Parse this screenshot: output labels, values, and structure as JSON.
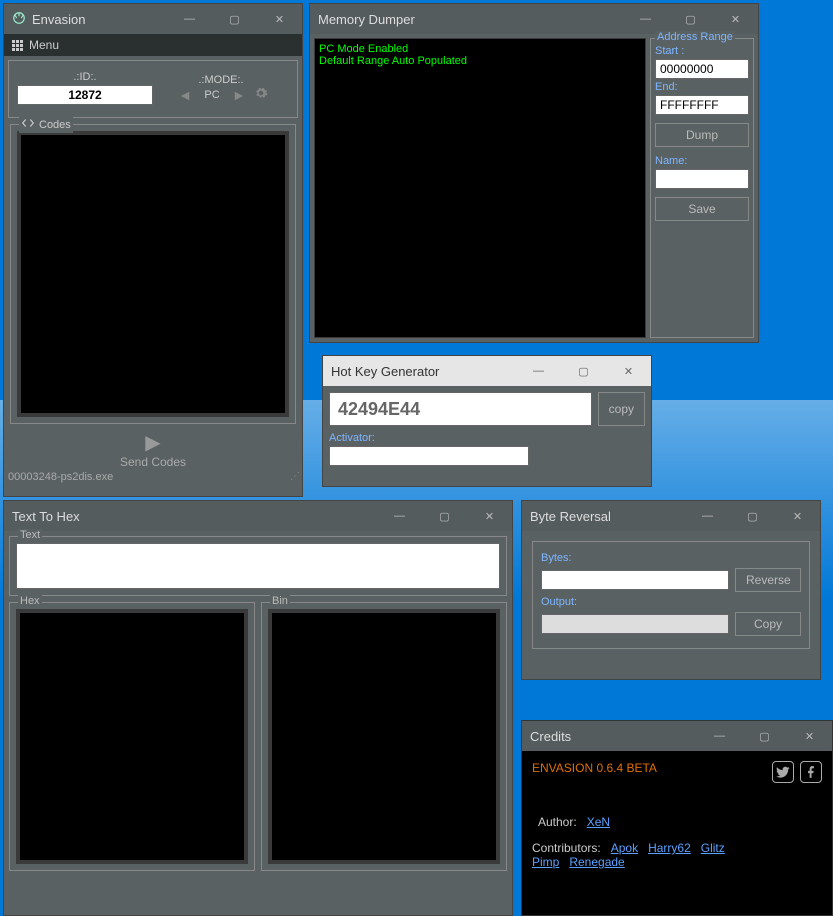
{
  "envasion": {
    "title": "Envasion",
    "menu": "Menu",
    "id_label": ".:ID:.",
    "id_value": "12872",
    "mode_label": ".:MODE:.",
    "mode_value": "PC",
    "codes_label": "Codes",
    "send_codes": "Send Codes",
    "status": "00003248-ps2dis.exe"
  },
  "memdumper": {
    "title": "Memory Dumper",
    "console_line1": "PC Mode Enabled",
    "console_line2": "Default Range Auto Populated",
    "range_label": "Address Range",
    "start_label": "Start :",
    "start_value": "00000000",
    "end_label": "End:",
    "end_value": "FFFFFFFF",
    "dump": "Dump",
    "name_label": "Name:",
    "name_value": "",
    "save": "Save"
  },
  "hotkey": {
    "title": "Hot Key Generator",
    "value": "42494E44",
    "copy": "copy",
    "activator_label": "Activator:",
    "activator_value": ""
  },
  "texttohex": {
    "title": "Text To Hex",
    "text_label": "Text",
    "hex_label": "Hex",
    "bin_label": "Bin"
  },
  "byterev": {
    "title": "Byte Reversal",
    "bytes_label": "Bytes:",
    "bytes_value": "",
    "output_label": "Output:",
    "output_value": "",
    "reverse": "Reverse",
    "copy": "Copy"
  },
  "credits": {
    "title": "Credits",
    "version": "ENVASION 0.6.4 BETA",
    "author_label": "Author:",
    "author": "XeN",
    "contrib_label": "Contributors:",
    "contribs": [
      "Apok",
      "Harry62",
      "Glitz Pimp",
      "Renegade"
    ]
  }
}
